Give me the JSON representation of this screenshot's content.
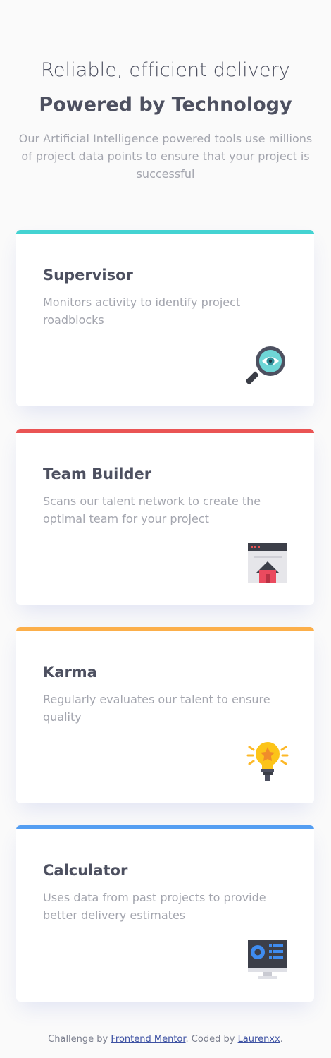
{
  "header": {
    "subtitle": "Reliable, efficient delivery",
    "title": "Powered by Technology",
    "description": "Our Artificial Intelligence powered tools use millions of project data points to ensure that your project is successful"
  },
  "cards": [
    {
      "title": "Supervisor",
      "text": "Monitors activity to identify project roadblocks",
      "icon": "magnifier-eye-icon",
      "accent": "#44d3d2"
    },
    {
      "title": "Team Builder",
      "text": "Scans our talent network to create the optimal team for your project",
      "icon": "browser-home-icon",
      "accent": "#ea5454"
    },
    {
      "title": "Karma",
      "text": "Regularly evaluates our talent to ensure quality",
      "icon": "lightbulb-icon",
      "accent": "#fcaf4a"
    },
    {
      "title": "Calculator",
      "text": "Uses data from past projects to provide better delivery estimates",
      "icon": "monitor-chart-icon",
      "accent": "#549ef2"
    }
  ],
  "footer": {
    "prefix": "Challenge by ",
    "link1": "Frontend Mentor",
    "middle": ". Coded by ",
    "link2": "Laurenxx",
    "suffix": "."
  }
}
